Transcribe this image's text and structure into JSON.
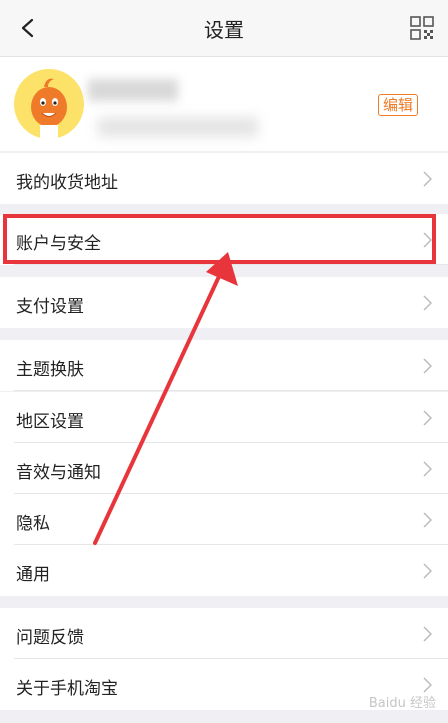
{
  "header": {
    "title": "设置",
    "back_icon": "back-arrow-icon",
    "qr_icon": "qr-code-icon"
  },
  "profile": {
    "edit_label": "编辑"
  },
  "groups": [
    {
      "items": [
        {
          "label": "我的收货地址"
        }
      ]
    },
    {
      "items": [
        {
          "label": "账户与安全"
        },
        {
          "label": "支付设置"
        }
      ]
    },
    {
      "items": [
        {
          "label": "主题换肤"
        },
        {
          "label": "地区设置"
        },
        {
          "label": "音效与通知"
        },
        {
          "label": "隐私"
        },
        {
          "label": "通用"
        }
      ]
    },
    {
      "items": [
        {
          "label": "问题反馈"
        },
        {
          "label": "关于手机淘宝"
        }
      ]
    }
  ],
  "annotation": {
    "highlight_color": "#e8353b"
  },
  "watermark": "Baidu 经验"
}
